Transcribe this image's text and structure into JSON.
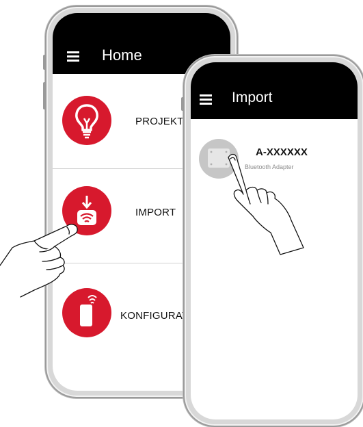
{
  "home_screen": {
    "title": "Home",
    "menu": [
      {
        "label": "PROJEKTE",
        "icon": "lightbulb-icon"
      },
      {
        "label": "IMPORT",
        "icon": "import-wifi-icon"
      },
      {
        "label": "KONFIGURATION",
        "icon": "remote-control-icon"
      }
    ]
  },
  "import_screen": {
    "title": "Import",
    "device": {
      "name": "A-XXXXXX",
      "subtitle": "Bluetooth Adapter",
      "icon": "adapter-icon"
    }
  },
  "colors": {
    "appbar": "#000000",
    "accent_red": "#d7192d",
    "frame": "#9a9a9a"
  }
}
